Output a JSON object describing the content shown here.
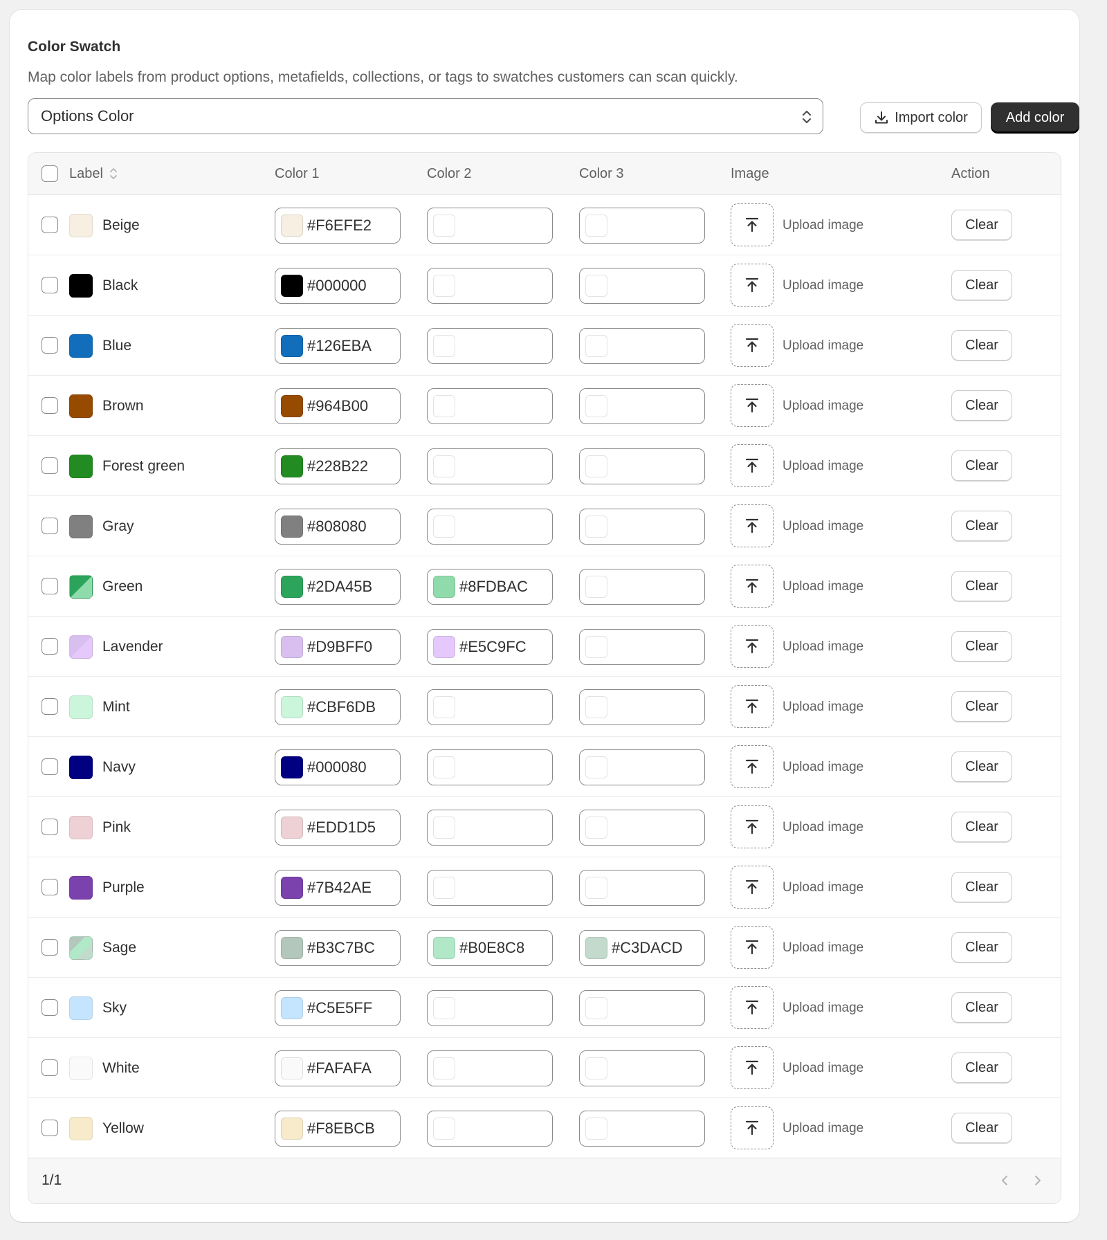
{
  "header": {
    "title": "Color Swatch",
    "subtitle": "Map color labels from product options, metafields, collections, or tags to swatches customers can scan quickly."
  },
  "toolbar": {
    "select_value": "Options Color",
    "import_label": "Import color",
    "add_label": "Add color"
  },
  "table": {
    "columns": {
      "label": "Label",
      "color1": "Color 1",
      "color2": "Color 2",
      "color3": "Color 3",
      "image": "Image",
      "action": "Action"
    },
    "upload_text": "Upload image",
    "clear_label": "Clear",
    "rows": [
      {
        "label": "Beige",
        "colors": [
          "#F6EFE2"
        ]
      },
      {
        "label": "Black",
        "colors": [
          "#000000"
        ]
      },
      {
        "label": "Blue",
        "colors": [
          "#126EBA"
        ]
      },
      {
        "label": "Brown",
        "colors": [
          "#964B00"
        ]
      },
      {
        "label": "Forest green",
        "colors": [
          "#228B22"
        ]
      },
      {
        "label": "Gray",
        "colors": [
          "#808080"
        ]
      },
      {
        "label": "Green",
        "colors": [
          "#2DA45B",
          "#8FDBAC"
        ]
      },
      {
        "label": "Lavender",
        "colors": [
          "#D9BFF0",
          "#E5C9FC"
        ]
      },
      {
        "label": "Mint",
        "colors": [
          "#CBF6DB"
        ]
      },
      {
        "label": "Navy",
        "colors": [
          "#000080"
        ]
      },
      {
        "label": "Pink",
        "colors": [
          "#EDD1D5"
        ]
      },
      {
        "label": "Purple",
        "colors": [
          "#7B42AE"
        ]
      },
      {
        "label": "Sage",
        "colors": [
          "#B3C7BC",
          "#B0E8C8",
          "#C3DACD"
        ]
      },
      {
        "label": "Sky",
        "colors": [
          "#C5E5FF"
        ]
      },
      {
        "label": "White",
        "colors": [
          "#FAFAFA"
        ]
      },
      {
        "label": "Yellow",
        "colors": [
          "#F8EBCB"
        ]
      }
    ]
  },
  "pagination": {
    "page_text": "1/1"
  }
}
